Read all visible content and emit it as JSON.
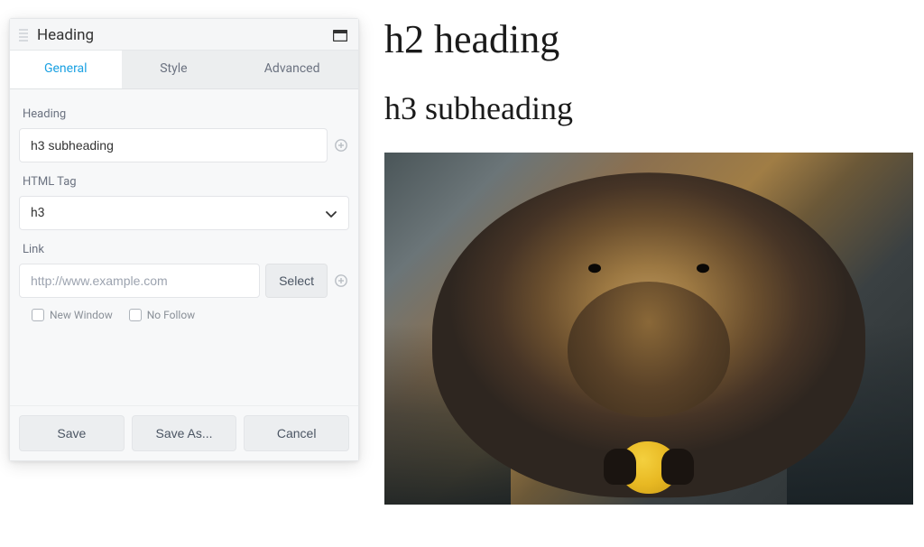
{
  "panel": {
    "title": "Heading",
    "tabs": {
      "general": "General",
      "style": "Style",
      "advanced": "Advanced"
    },
    "fields": {
      "heading_label": "Heading",
      "heading_value": "h3 subheading",
      "htmltag_label": "HTML Tag",
      "htmltag_value": "h3",
      "link_label": "Link",
      "link_placeholder": "http://www.example.com",
      "select_button": "Select",
      "new_window_label": "New Window",
      "no_follow_label": "No Follow"
    },
    "footer": {
      "save": "Save",
      "save_as": "Save As...",
      "cancel": "Cancel"
    }
  },
  "preview": {
    "h2": "h2 heading",
    "h3": "h3 subheading",
    "image_alt": "beaver-eating-fruit"
  }
}
